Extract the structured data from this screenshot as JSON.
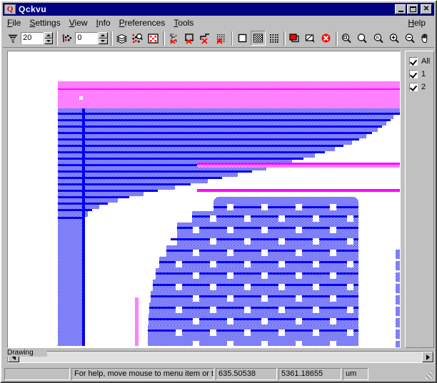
{
  "window": {
    "title": "Qckvu",
    "icon": "app-icon",
    "controls": {
      "minimize": "–",
      "maximize": "□",
      "close": "✕"
    }
  },
  "menubar": {
    "items": [
      {
        "label": "File",
        "accel": "F"
      },
      {
        "label": "Settings",
        "accel": "S"
      },
      {
        "label": "View",
        "accel": "V"
      },
      {
        "label": "Info",
        "accel": "I"
      },
      {
        "label": "Preferences",
        "accel": "P"
      },
      {
        "label": "Tools",
        "accel": "T"
      }
    ],
    "help": {
      "label": "Help",
      "accel": "H"
    }
  },
  "toolbar": {
    "filter_icon": "funnel-icon",
    "filter_value": "20",
    "select_icon": "select-points-icon",
    "select_value": "0",
    "buttons": [
      {
        "name": "layers-icon",
        "pressed": false
      },
      {
        "name": "query-magnifier-icon",
        "pressed": false
      },
      {
        "name": "cell-grid-icon",
        "pressed": false
      },
      {
        "name": "text-off-icon",
        "pressed": false
      },
      {
        "name": "box-off-icon",
        "pressed": false
      },
      {
        "name": "polyline-off-icon",
        "pressed": false
      },
      {
        "name": "fill-off-icon",
        "pressed": false
      },
      {
        "name": "outline-fill-icon",
        "pressed": false
      },
      {
        "name": "checker-fill-icon",
        "pressed": true
      },
      {
        "name": "dot-fill-icon",
        "pressed": false
      },
      {
        "name": "copy-layer-icon",
        "pressed": false
      },
      {
        "name": "edit-layer-icon",
        "pressed": false
      },
      {
        "name": "cancel-icon",
        "pressed": false
      },
      {
        "name": "zoom-window-icon",
        "pressed": false
      },
      {
        "name": "zoom-all-icon",
        "pressed": false
      },
      {
        "name": "zoom-previous-icon",
        "pressed": false
      },
      {
        "name": "zoom-in-icon",
        "pressed": false
      },
      {
        "name": "zoom-out-icon",
        "pressed": false
      },
      {
        "name": "pan-hand-icon",
        "pressed": false
      }
    ]
  },
  "layer_panel": {
    "layers": [
      {
        "label": "All",
        "checked": true
      },
      {
        "label": "1",
        "checked": true
      },
      {
        "label": "2",
        "checked": true
      }
    ]
  },
  "canvas": {
    "drawing_label": "Drawing",
    "colors": {
      "layer1_magenta": "#ff00ff",
      "layer2_blue": "#0000ee",
      "overlap_purple": "#8800ee",
      "background": "#ffffff"
    }
  },
  "scrollbar": {
    "left_arrow": "◄",
    "right_arrow": "►"
  },
  "statusbar": {
    "pane1": "",
    "help_text": "For help, move mouse to menu item or t",
    "coord_x": "635.50538",
    "coord_y": "5361.18655",
    "units": "um"
  }
}
